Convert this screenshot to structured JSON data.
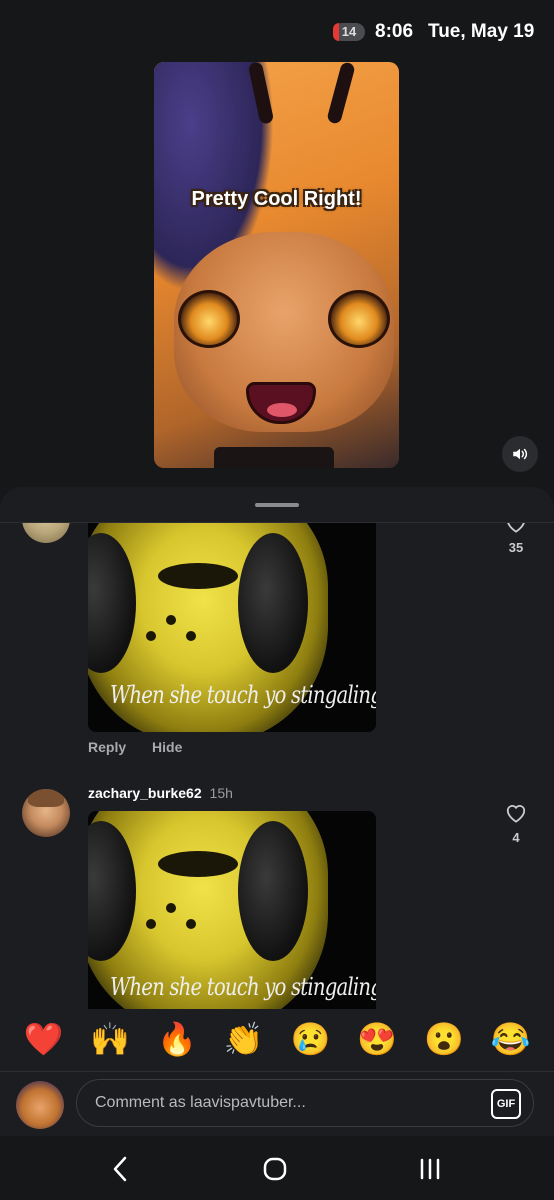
{
  "status_bar": {
    "notification_count": "14",
    "time": "8:06",
    "date": "Tue, May 19"
  },
  "video": {
    "caption": "Pretty Cool Right!"
  },
  "comments": [
    {
      "gif_caption": "When she touch yo stingaling",
      "likes": "35",
      "reply_label": "Reply",
      "hide_label": "Hide"
    },
    {
      "username": "zachary_burke62",
      "time": "15h",
      "gif_caption": "When she touch yo stingaling",
      "likes": "4"
    }
  ],
  "emoji_bar": [
    "❤️",
    "🙌",
    "🔥",
    "👏",
    "😢",
    "😍",
    "😮",
    "😂"
  ],
  "composer": {
    "placeholder": "Comment as laavispavtuber...",
    "gif_label": "GIF"
  }
}
